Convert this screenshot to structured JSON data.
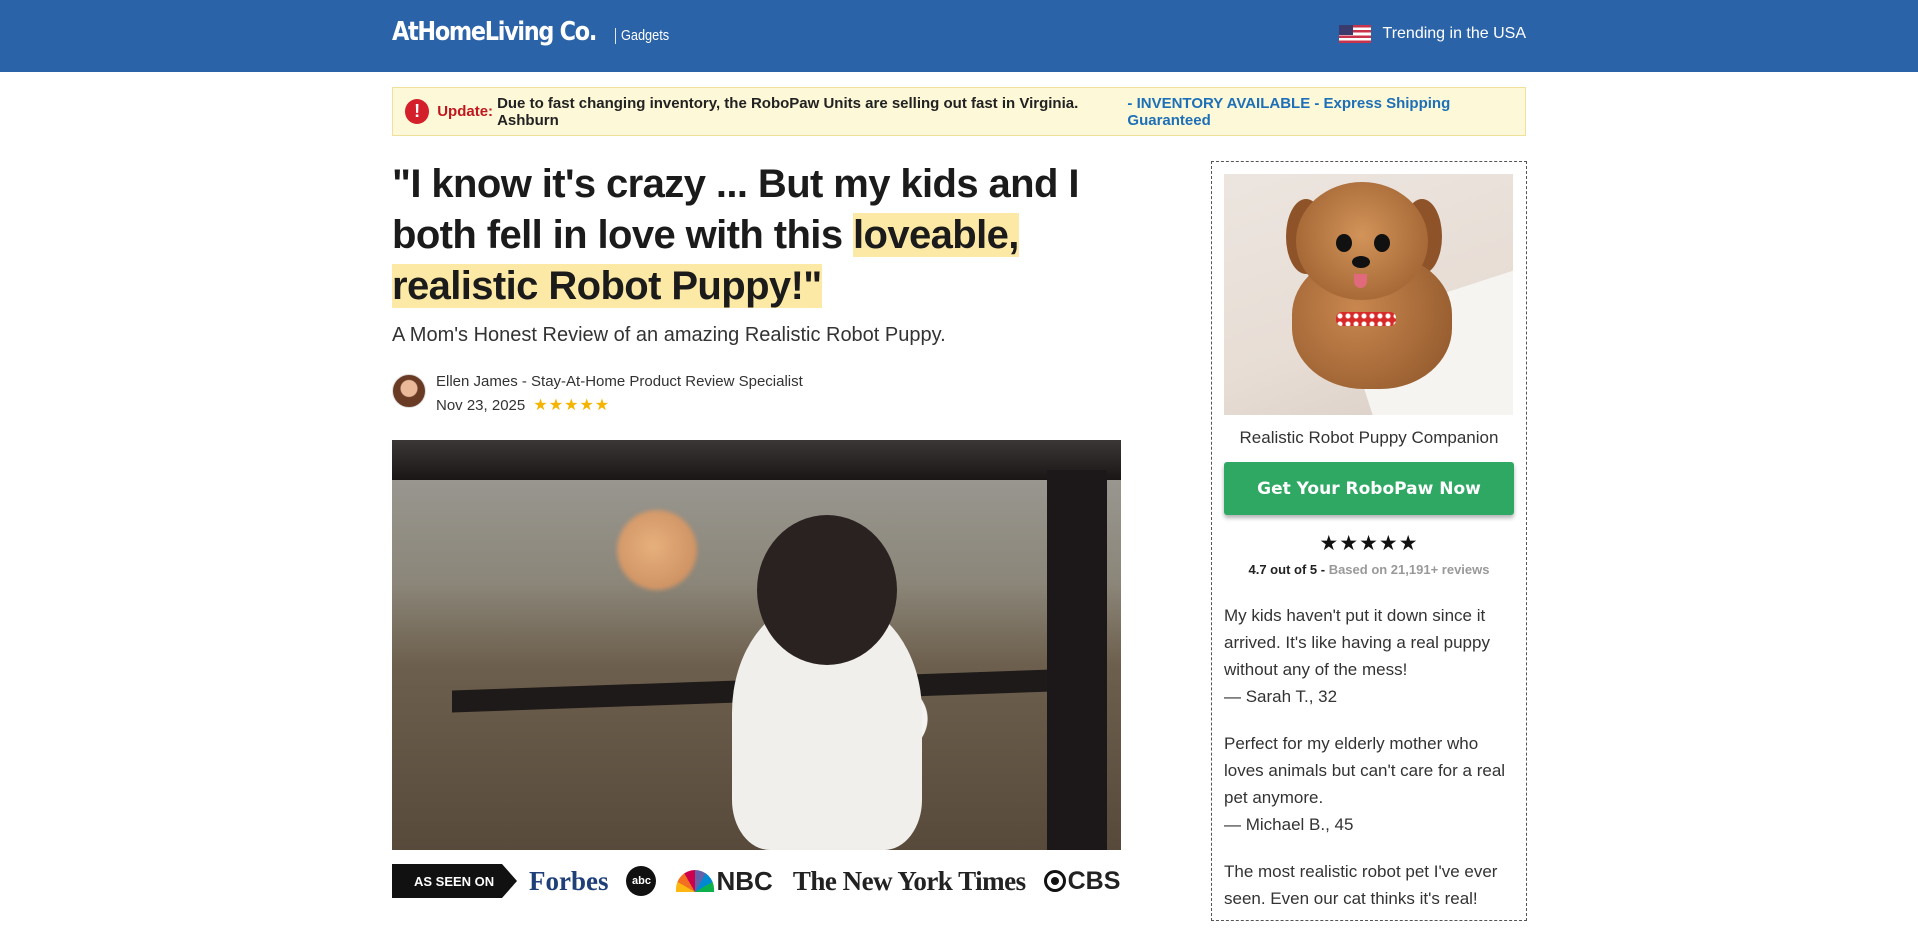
{
  "header": {
    "brand": "AtHomeLiving Co.",
    "brand_sub": "Gadgets",
    "trending": "Trending in the USA",
    "bg_color": "#2b63a8"
  },
  "alert": {
    "icon": "!",
    "label": "Update:",
    "text": "Due to fast changing inventory, the RoboPaw Units are selling out fast in Virginia. Ashburn",
    "availability": "- INVENTORY AVAILABLE - Express Shipping Guaranteed"
  },
  "article": {
    "headline_plain": "\"I know it's crazy ... But my kids and I both fell in love with this ",
    "headline_highlight": "loveable, realistic Robot Puppy!\"",
    "subheadline": "A Mom's Honest Review of an amazing Realistic Robot Puppy.",
    "author": "Ellen James - Stay-At-Home Product Review Specialist",
    "date": "Nov 23, 2025",
    "stars": "★★★★★"
  },
  "as_seen_on": {
    "label": "AS SEEN ON",
    "logos": {
      "forbes": "Forbes",
      "abc": "abc",
      "nbc": "NBC",
      "nyt": "The New York Times",
      "cbs": "CBS"
    }
  },
  "sidebar": {
    "product_name": "Realistic Robot Puppy Companion",
    "cta_label": "Get Your RoboPaw Now",
    "stars": "★★★★★",
    "score": "4.7 out of 5 -",
    "based_on": "Based on 21,191+ reviews",
    "testimonials": [
      {
        "quote": "My kids haven't put it down since it arrived. It's like having a real puppy without any of the mess!",
        "author": "— Sarah T., 32"
      },
      {
        "quote": "Perfect for my elderly mother who loves animals but can't care for a real pet anymore.",
        "author": "— Michael B., 45"
      },
      {
        "quote": "The most realistic robot pet I've ever seen. Even our cat thinks it's real!",
        "author": ""
      }
    ],
    "cta_color": "#2fa864"
  }
}
